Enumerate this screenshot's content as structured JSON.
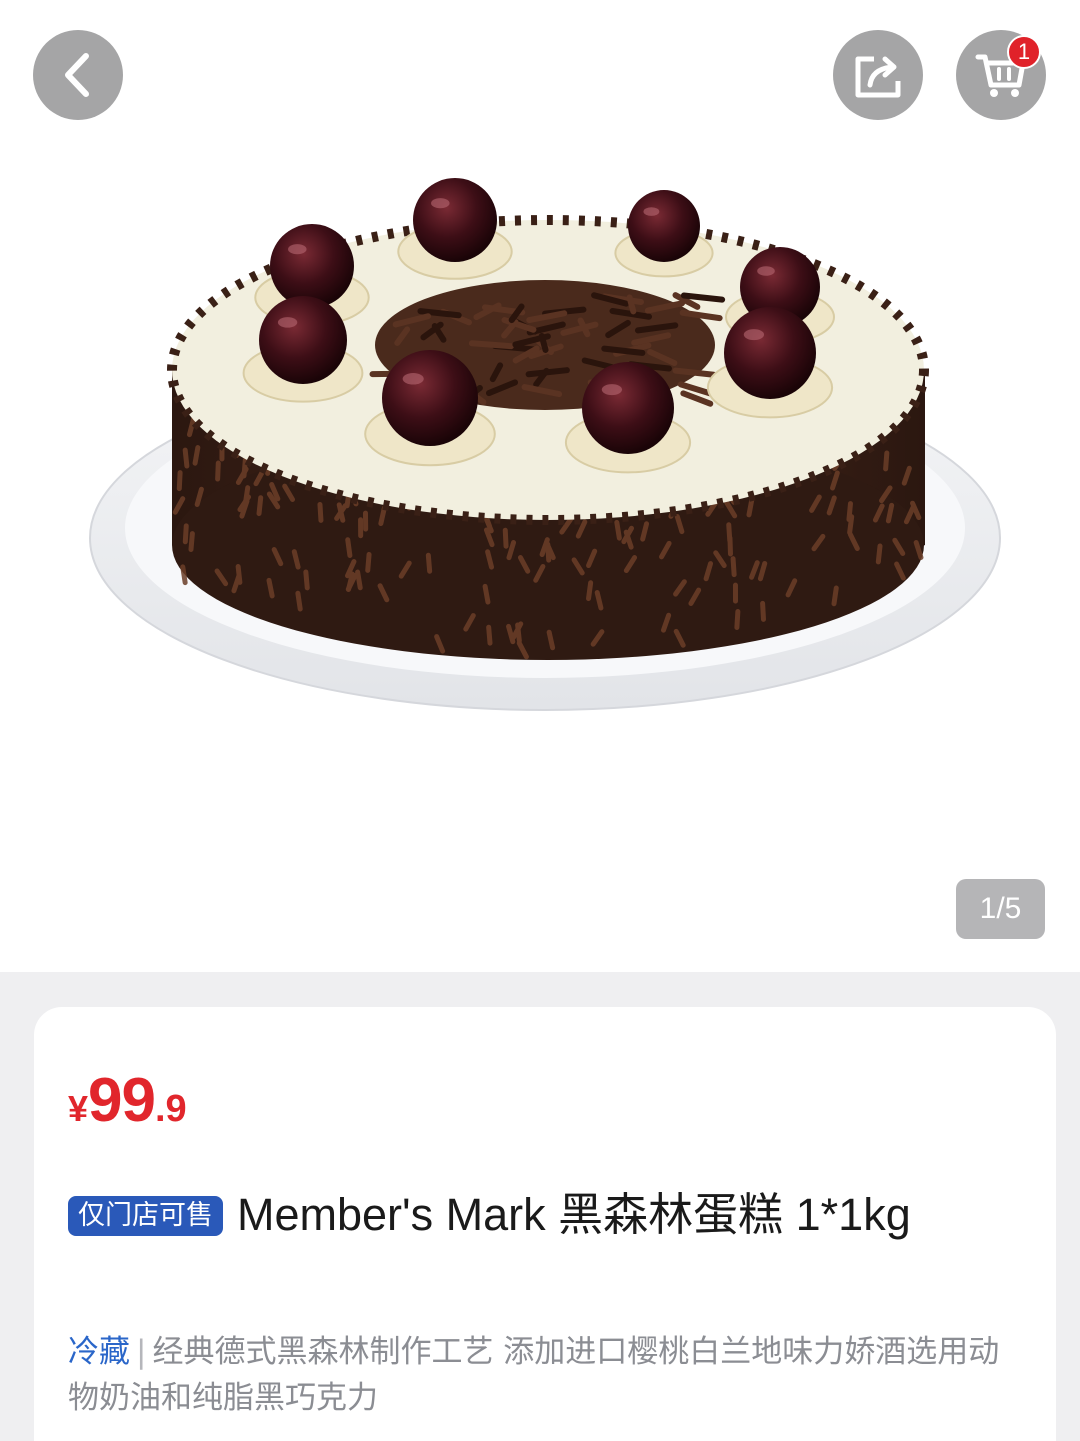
{
  "header": {
    "back_icon": "chevron-left-icon",
    "share_icon": "share-icon",
    "cart_icon": "cart-icon",
    "cart_count": "1"
  },
  "gallery": {
    "image_alt": "黑森林蛋糕",
    "indicator": "1/5"
  },
  "product": {
    "price": {
      "currency": "¥",
      "integer": "99",
      "decimal": ".9"
    },
    "tag": "仅门店可售",
    "title": "Member's Mark 黑森林蛋糕 1*1kg",
    "storage": "冷藏",
    "separator": "|",
    "description": "经典德式黑森林制作工艺 添加进口樱桃白兰地味力娇酒选用动物奶油和纯脂黑巧克力"
  },
  "colors": {
    "price": "#e1262c",
    "tag_bg": "#2a59b9",
    "storage": "#2a66c9",
    "badge": "#e0222a"
  }
}
